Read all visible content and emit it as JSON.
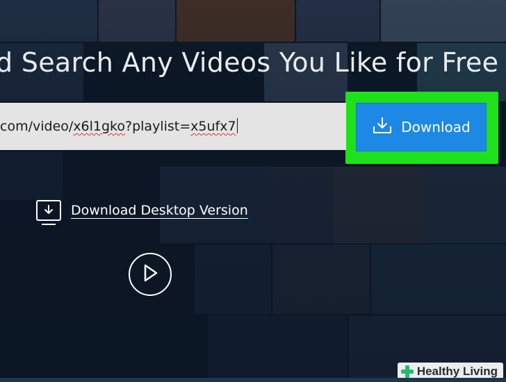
{
  "headline": "d Search Any Videos You Like for Free",
  "url_input": {
    "prefix": "com/video/",
    "id": "x6l1gko",
    "mid": "?playlist=",
    "playlist": "x5ufx7"
  },
  "download_button": {
    "label": "Download",
    "icon": "download-tray-icon"
  },
  "desktop_link": {
    "label": "Download Desktop Version",
    "icon": "monitor-download-icon"
  },
  "play_button": {
    "icon": "play-icon"
  },
  "watermark": {
    "label": "Healthy Living",
    "icon": "plus-cross-icon"
  },
  "colors": {
    "highlight": "#1ee01b",
    "button": "#1e88e5",
    "input_bg": "#e4e4e4",
    "background": "#0e1a29"
  }
}
